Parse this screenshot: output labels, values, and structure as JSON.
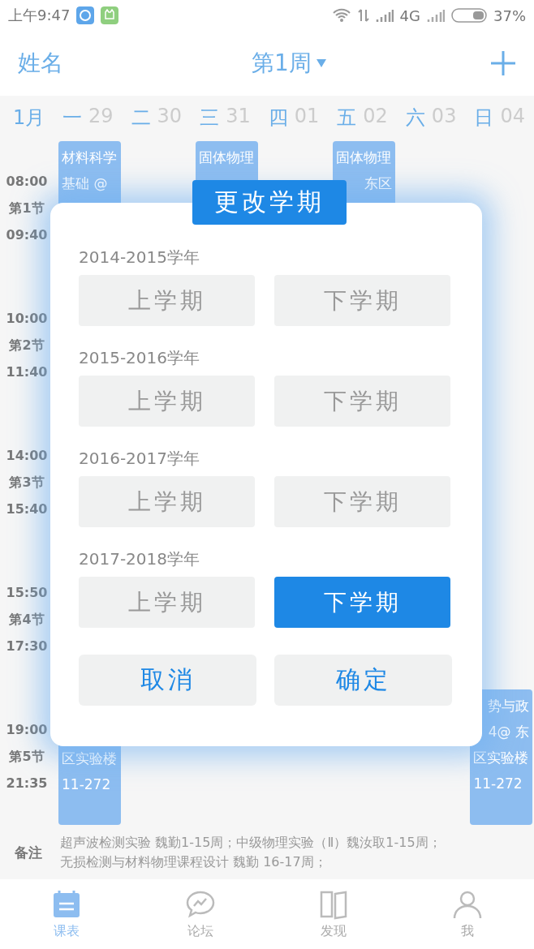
{
  "status_bar": {
    "time": "上午9:47",
    "network": "4G",
    "battery": "37%"
  },
  "header": {
    "title": "姓名",
    "week": "第1周"
  },
  "week_header": {
    "month": "1月",
    "days": [
      {
        "weekday": "一",
        "date": "29",
        "courses": [
          {
            "kind": "all",
            "lines": [
              {
                "text": "材料科学",
                "covered": false
              },
              {
                "text": "基础 @",
                "covered": false
              }
            ],
            "bottom_lines": [
              "区实验楼",
              "11-272"
            ]
          }
        ]
      },
      {
        "weekday": "二",
        "date": "30"
      },
      {
        "weekday": "三",
        "date": "31",
        "courses": [
          {
            "kind": "first",
            "lines": [
              {
                "text": "固体物理",
                "covered": false
              }
            ]
          }
        ]
      },
      {
        "weekday": "四",
        "date": "01"
      },
      {
        "weekday": "五",
        "date": "02",
        "courses": [
          {
            "kind": "first",
            "lines": [
              {
                "text": "固体物理",
                "covered": false
              },
              {
                "text": "东区",
                "covered": true
              }
            ]
          }
        ]
      },
      {
        "weekday": "六",
        "date": "03"
      },
      {
        "weekday": "日",
        "date": "04",
        "courses": [
          {
            "kind": "last",
            "lines": [
              {
                "text": "势与政",
                "covered": true
              },
              {
                "text": "4@ 东",
                "covered": true
              },
              {
                "text": "区实验楼",
                "covered": false
              },
              {
                "text": "11-272",
                "covered": false
              }
            ]
          }
        ]
      }
    ]
  },
  "periods": [
    {
      "start": "08:00",
      "label": "第1节",
      "end": "09:40"
    },
    {
      "start": "10:00",
      "label": "第2节",
      "end": "11:40"
    },
    {
      "start": "14:00",
      "label": "第3节",
      "end": "15:40"
    },
    {
      "start": "15:50",
      "label": "第4节",
      "end": "17:30"
    },
    {
      "start": "19:00",
      "label": "第5节",
      "end": "21:35"
    }
  ],
  "notes": {
    "label": "备注",
    "lines": [
      "超声波检测实验  魏勤1-15周；中级物理实验（Ⅱ）魏汝取1-15周；",
      "无损检测与材料物理课程设计 魏勤 16-17周；"
    ]
  },
  "dialog": {
    "title": "更改学期",
    "terms": [
      {
        "year": "2014-2015学年",
        "options": [
          {
            "label": "上学期",
            "selected": false
          },
          {
            "label": "下学期",
            "selected": false
          }
        ]
      },
      {
        "year": "2015-2016学年",
        "options": [
          {
            "label": "上学期",
            "selected": false
          },
          {
            "label": "下学期",
            "selected": false
          }
        ]
      },
      {
        "year": "2016-2017学年",
        "options": [
          {
            "label": "上学期",
            "selected": false
          },
          {
            "label": "下学期",
            "selected": false
          }
        ]
      },
      {
        "year": "2017-2018学年",
        "options": [
          {
            "label": "上学期",
            "selected": false
          },
          {
            "label": "下学期",
            "selected": true
          }
        ]
      }
    ],
    "actions": [
      {
        "label": "取消"
      },
      {
        "label": "确定"
      }
    ]
  },
  "tab_bar": [
    {
      "kind": "schedule",
      "label": "课表",
      "selected": true
    },
    {
      "kind": "forum",
      "label": "论坛",
      "selected": false
    },
    {
      "kind": "discover",
      "label": "发现",
      "selected": false
    },
    {
      "kind": "profile",
      "label": "我",
      "selected": false
    }
  ]
}
